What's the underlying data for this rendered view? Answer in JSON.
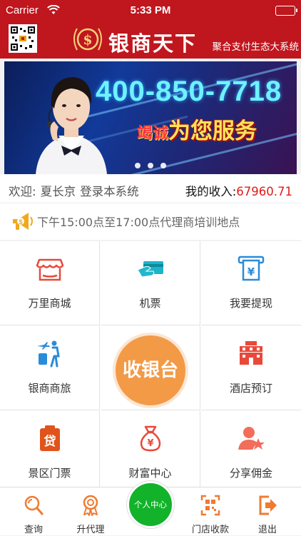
{
  "status_bar": {
    "carrier": "Carrier",
    "time": "5:33 PM"
  },
  "header": {
    "brand": "银商天下",
    "tagline": "聚合支付生态大系统"
  },
  "banner": {
    "phone": "400-850-7718",
    "slogan_prefix": "竭诚",
    "slogan": "为您服务",
    "page_dots": 3
  },
  "welcome": {
    "greeting": "欢迎:",
    "username": "夏长京",
    "suffix": "登录本系统",
    "income_label": "我的收入:",
    "income_value": "67960.71"
  },
  "notice": {
    "text": "下午15:00点至17:00点代理商培训地点"
  },
  "grid": [
    {
      "label": "万里商城",
      "icon": "shop-icon"
    },
    {
      "label": "机票",
      "icon": "ticket-card-icon"
    },
    {
      "label": "我要提现",
      "icon": "withdraw-icon"
    },
    {
      "label": "银商商旅",
      "icon": "travel-icon"
    },
    {
      "label": "",
      "icon": ""
    },
    {
      "label": "酒店预订",
      "icon": "hotel-icon"
    },
    {
      "label": "景区门票",
      "icon": "loan-icon"
    },
    {
      "label": "财富中心",
      "icon": "money-bag-icon"
    },
    {
      "label": "分享佣金",
      "icon": "user-star-icon"
    }
  ],
  "cashier": {
    "label": "收银台"
  },
  "tabbar": {
    "items": [
      {
        "label": "查询",
        "icon": "search-icon"
      },
      {
        "label": "升代理",
        "icon": "medal-icon"
      },
      {
        "label": "门店收款",
        "icon": "scan-icon"
      },
      {
        "label": "退出",
        "icon": "exit-icon"
      }
    ],
    "center": "个人中心"
  },
  "colors": {
    "brand_red": "#c0161e",
    "orange": "#f39a47",
    "green": "#12b32a",
    "income_red": "#e01a1a"
  }
}
